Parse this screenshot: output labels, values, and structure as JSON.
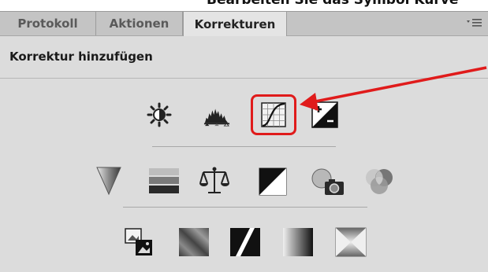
{
  "header_fragment": "Bearbeiten Sie das Symbol Kurve",
  "tabs": [
    {
      "label": "Protokoll",
      "active": false
    },
    {
      "label": "Aktionen",
      "active": false
    },
    {
      "label": "Korrekturen",
      "active": true
    }
  ],
  "panel": {
    "title": "Korrektur hinzufügen"
  },
  "icons": {
    "row1": [
      "brightness-contrast-icon",
      "levels-icon",
      "curves-icon",
      "exposure-icon"
    ],
    "row2": [
      "vibrance-icon",
      "hue-saturation-icon",
      "color-balance-icon",
      "black-white-icon",
      "photo-filter-icon",
      "channel-mixer-icon"
    ],
    "row3": [
      "invert-icon",
      "posterize-icon",
      "threshold-icon",
      "gradient-map-icon",
      "selective-color-icon"
    ]
  },
  "colors": {
    "highlight": "#e01b1b",
    "panel_bg": "#dcdcdc",
    "tabbar_bg": "#c4c4c4"
  }
}
